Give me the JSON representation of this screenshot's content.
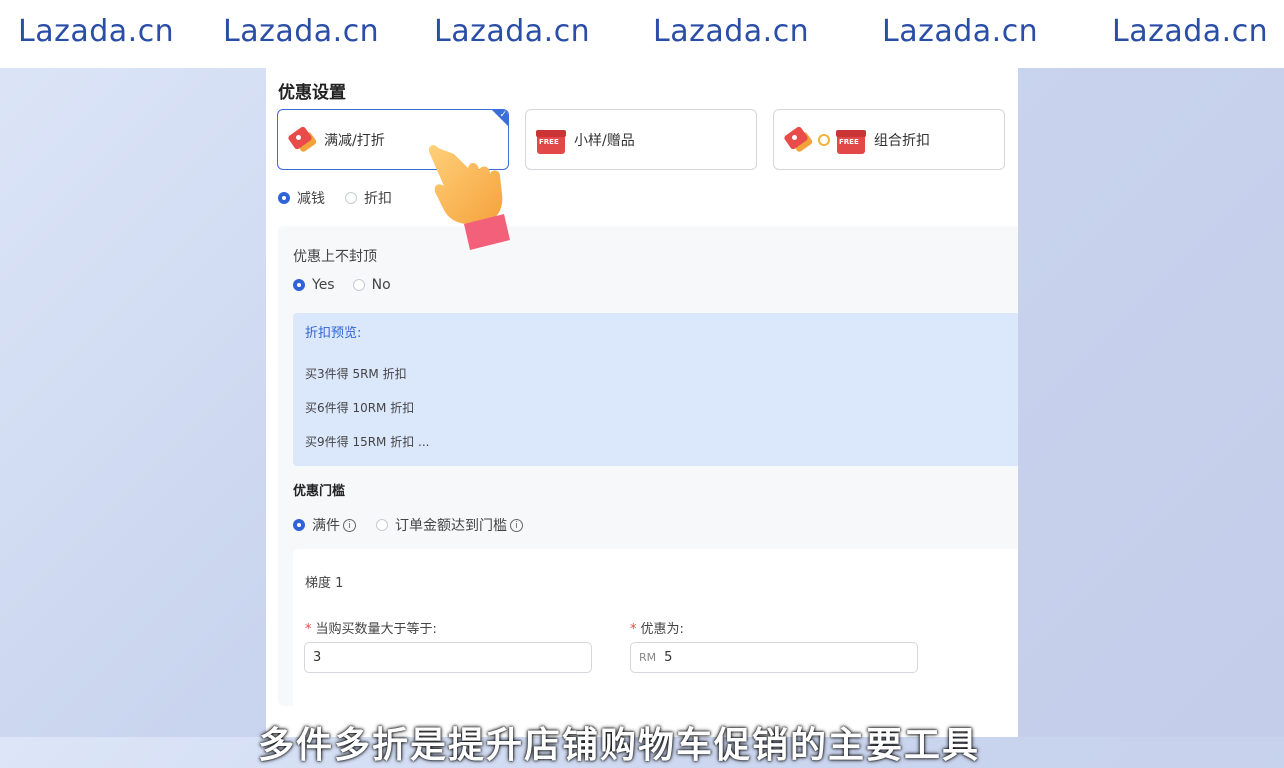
{
  "watermark": {
    "text": "Lazada.cn",
    "count": 6,
    "color": "#2a4ea6"
  },
  "section": {
    "title": "优惠设置"
  },
  "cards": [
    {
      "label": "满减/打折",
      "icon": "price-tag-icon",
      "selected": true
    },
    {
      "label": "小样/赠品",
      "icon": "free-gift-icon",
      "selected": false
    },
    {
      "label": "组合折扣",
      "icon": "tag-plus-gift-icon",
      "selected": false
    }
  ],
  "discount_type": {
    "options": [
      "减钱",
      "折扣"
    ],
    "selected": "减钱"
  },
  "cap": {
    "label": "优惠上不封顶",
    "options": [
      "Yes",
      "No"
    ],
    "selected": "Yes"
  },
  "preview": {
    "title": "折扣预览:",
    "lines": [
      "买3件得 5RM 折扣",
      "买6件得 10RM 折扣",
      "买9件得 15RM 折扣 ..."
    ]
  },
  "threshold": {
    "label": "优惠门槛",
    "options": [
      "满件",
      "订单金额达到门槛"
    ],
    "selected": "满件"
  },
  "tier": {
    "title": "梯度 1",
    "qty_label": "当购买数量大于等于:",
    "qty_value": "3",
    "discount_label": "优惠为:",
    "discount_prefix": "RM",
    "discount_value": "5"
  },
  "subtitle": "多件多折是提升店铺购物车促销的主要工具",
  "colors": {
    "accent": "#2f64d6",
    "required": "#e04848"
  }
}
